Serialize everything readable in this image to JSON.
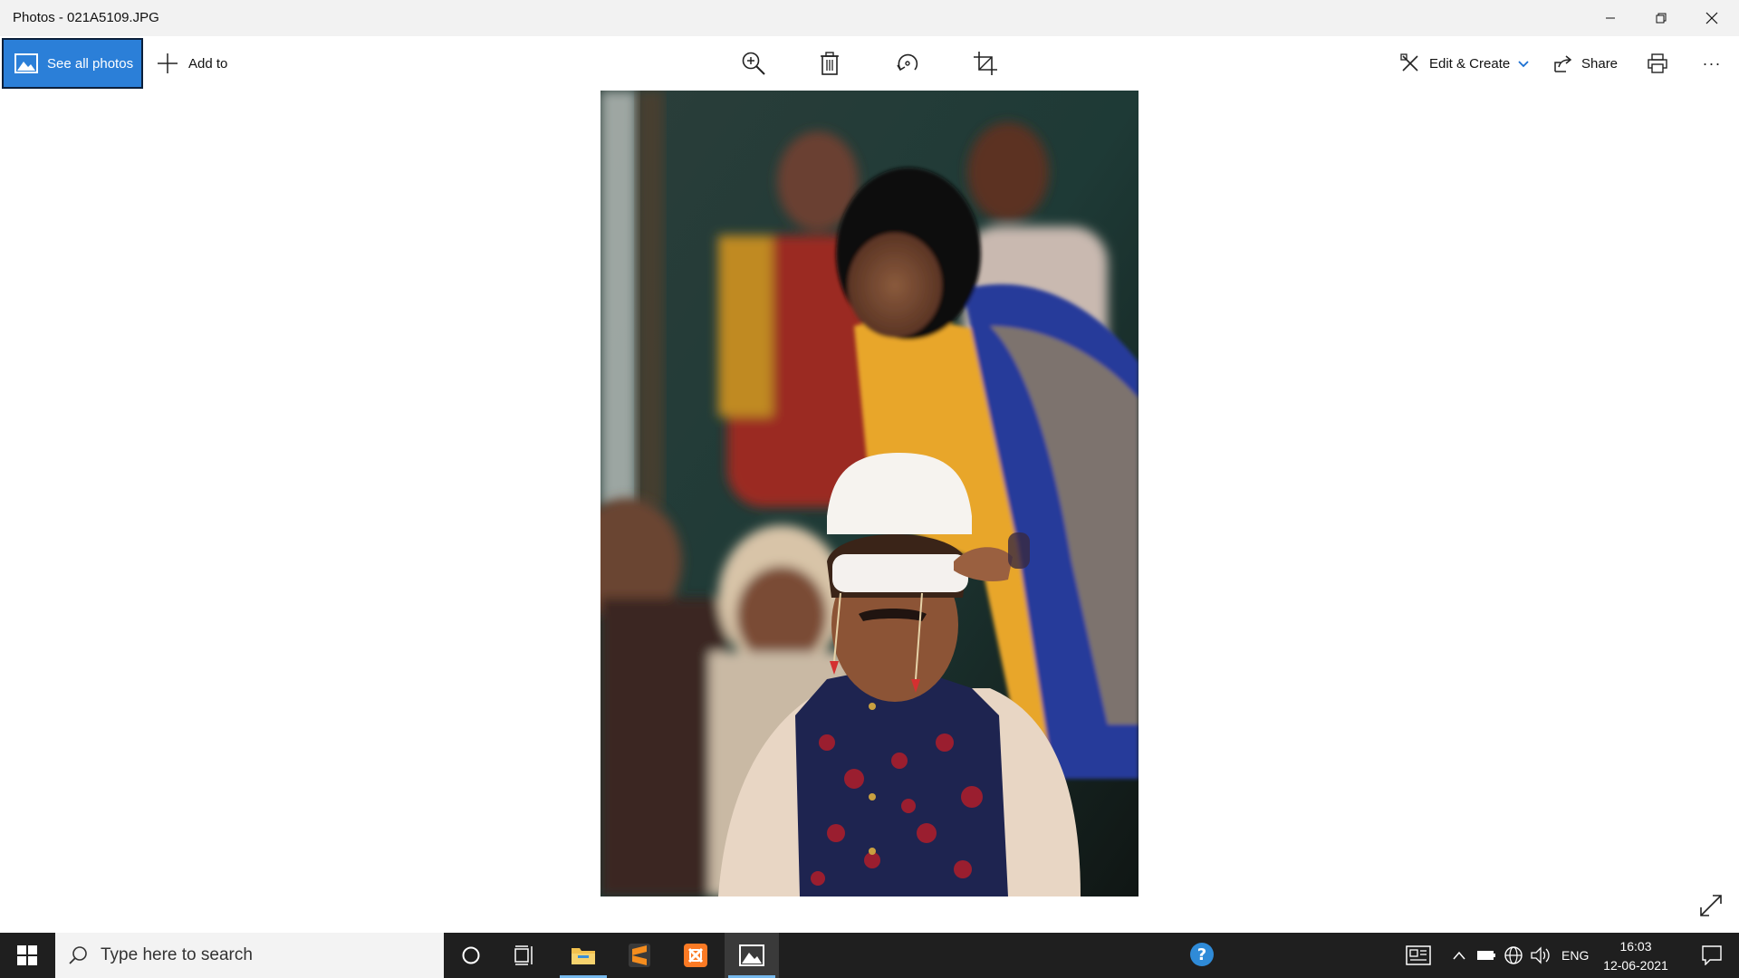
{
  "window": {
    "title": "Photos - 021A5109.JPG"
  },
  "toolbar": {
    "see_all_photos": "See all photos",
    "add_to": "Add to",
    "edit_create": "Edit & Create",
    "share": "Share",
    "more": "···",
    "icons": [
      "zoom-in-icon",
      "delete-icon",
      "rotate-icon",
      "crop-icon",
      "print-icon"
    ]
  },
  "viewer": {
    "photo_icon": "photo-of-wedding-ceremony"
  },
  "taskbar": {
    "search_placeholder": "Type here to search",
    "language": "ENG",
    "time": "16:03",
    "date": "12-06-2021",
    "pinned": [
      "file-explorer-icon",
      "sublime-text-icon",
      "xampp-icon",
      "photos-app-icon"
    ]
  },
  "colors": {
    "accent": "#2b7fd8",
    "taskbar": "#1f1f1f",
    "titlebar": "#f2f2f2"
  }
}
